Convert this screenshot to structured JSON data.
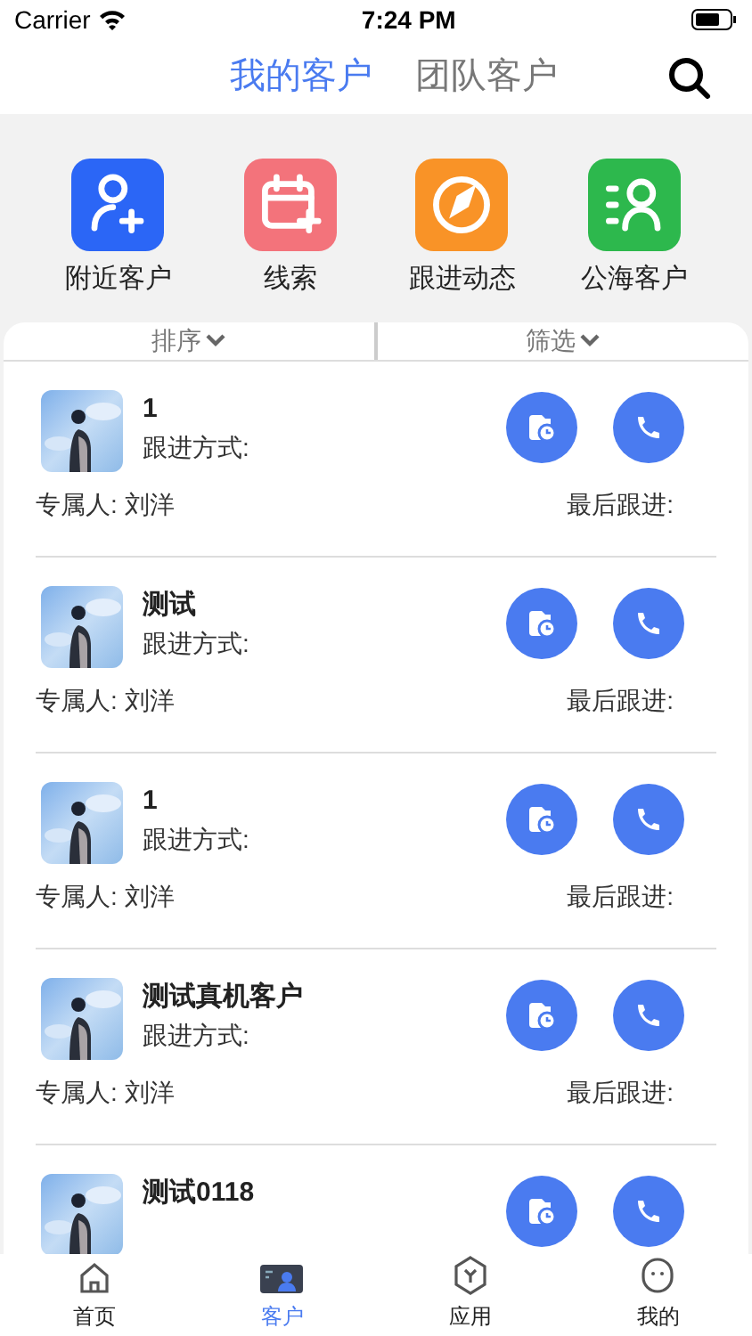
{
  "status_bar": {
    "carrier": "Carrier",
    "time": "7:24 PM"
  },
  "header_tabs": [
    {
      "label": "我的客户",
      "selected": true
    },
    {
      "label": "团队客户",
      "selected": false
    }
  ],
  "shortcuts": [
    {
      "label": "附近客户",
      "kind": "person-add",
      "color": "#2b66f6"
    },
    {
      "label": "线索",
      "kind": "calendar-add",
      "color": "#f3737b"
    },
    {
      "label": "跟进动态",
      "kind": "compass",
      "color": "#f99327"
    },
    {
      "label": "公海客户",
      "kind": "contacts",
      "color": "#2db84d"
    }
  ],
  "filters": [
    {
      "label": "排序"
    },
    {
      "label": "筛选"
    }
  ],
  "customers": [
    {
      "name": "1",
      "method_label": "跟进方式:",
      "owner_label": "专属人:",
      "owner": "刘洋",
      "last_label": "最后跟进:"
    },
    {
      "name": "测试",
      "method_label": "跟进方式:",
      "owner_label": "专属人:",
      "owner": "刘洋",
      "last_label": "最后跟进:"
    },
    {
      "name": "1",
      "method_label": "跟进方式:",
      "owner_label": "专属人:",
      "owner": "刘洋",
      "last_label": "最后跟进:"
    },
    {
      "name": "测试真机客户",
      "method_label": "跟进方式:",
      "owner_label": "专属人:",
      "owner": "刘洋",
      "last_label": "最后跟进:"
    },
    {
      "name": "测试0118"
    }
  ],
  "bottom_tabs": [
    {
      "label": "首页",
      "kind": "home",
      "selected": false
    },
    {
      "label": "客户",
      "kind": "customers",
      "selected": true
    },
    {
      "label": "应用",
      "kind": "apps",
      "selected": false
    },
    {
      "label": "我的",
      "kind": "me",
      "selected": false
    }
  ]
}
